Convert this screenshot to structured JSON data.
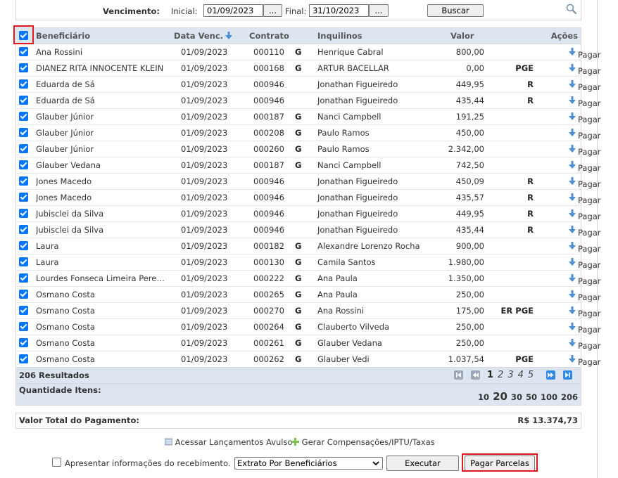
{
  "filter": {
    "label": "Vencimento:",
    "initial_label": "Inicial:",
    "initial_value": "01/09/2023",
    "final_label": "Final:",
    "final_value": "31/10/2023",
    "picker_label": "...",
    "search_label": "Buscar"
  },
  "table": {
    "headers": {
      "beneficiario": "Beneficiário",
      "data_venc": "Data Venc.",
      "contrato": "Contrato",
      "inquilinos": "Inquilinos",
      "valor": "Valor",
      "acoes": "Ações"
    },
    "pay_label": "Pagar",
    "rows": [
      {
        "beneficiario": "Ana Rossini",
        "data": "01/09/2023",
        "contrato": "000110",
        "g": "G",
        "inquilino": "Henrique Cabral",
        "valor": "800,00",
        "flag": ""
      },
      {
        "beneficiario": "DIANEZ RITA INNOCENTE KLEIN",
        "data": "01/09/2023",
        "contrato": "000168",
        "g": "G",
        "inquilino": "ARTUR BACELLAR",
        "valor": "0,00",
        "flag": "PGE"
      },
      {
        "beneficiario": "Eduarda de Sá",
        "data": "01/09/2023",
        "contrato": "000946",
        "g": "",
        "inquilino": "Jonathan Figueiredo",
        "valor": "449,95",
        "flag": "R"
      },
      {
        "beneficiario": "Eduarda de Sá",
        "data": "01/09/2023",
        "contrato": "000946",
        "g": "",
        "inquilino": "Jonathan Figueiredo",
        "valor": "435,44",
        "flag": "R"
      },
      {
        "beneficiario": "Glauber Júnior",
        "data": "01/09/2023",
        "contrato": "000187",
        "g": "G",
        "inquilino": "Nanci Campbell",
        "valor": "191,25",
        "flag": ""
      },
      {
        "beneficiario": "Glauber Júnior",
        "data": "01/09/2023",
        "contrato": "000208",
        "g": "G",
        "inquilino": "Paulo Ramos",
        "valor": "450,00",
        "flag": ""
      },
      {
        "beneficiario": "Glauber Júnior",
        "data": "01/09/2023",
        "contrato": "000260",
        "g": "G",
        "inquilino": "Paulo Ramos",
        "valor": "2.342,00",
        "flag": ""
      },
      {
        "beneficiario": "Glauber Vedana",
        "data": "01/09/2023",
        "contrato": "000187",
        "g": "G",
        "inquilino": "Nanci Campbell",
        "valor": "742,50",
        "flag": ""
      },
      {
        "beneficiario": "Jones Macedo",
        "data": "01/09/2023",
        "contrato": "000946",
        "g": "",
        "inquilino": "Jonathan Figueiredo",
        "valor": "450,09",
        "flag": "R"
      },
      {
        "beneficiario": "Jones Macedo",
        "data": "01/09/2023",
        "contrato": "000946",
        "g": "",
        "inquilino": "Jonathan Figueiredo",
        "valor": "435,57",
        "flag": "R"
      },
      {
        "beneficiario": "Jubisclei da Silva",
        "data": "01/09/2023",
        "contrato": "000946",
        "g": "",
        "inquilino": "Jonathan Figueiredo",
        "valor": "449,95",
        "flag": "R"
      },
      {
        "beneficiario": "Jubisclei da Silva",
        "data": "01/09/2023",
        "contrato": "000946",
        "g": "",
        "inquilino": "Jonathan Figueiredo",
        "valor": "435,44",
        "flag": "R"
      },
      {
        "beneficiario": "Laura",
        "data": "01/09/2023",
        "contrato": "000182",
        "g": "G",
        "inquilino": "Alexandre Lorenzo Rocha",
        "valor": "900,00",
        "flag": ""
      },
      {
        "beneficiario": "Laura",
        "data": "01/09/2023",
        "contrato": "000130",
        "g": "G",
        "inquilino": "Camila Santos",
        "valor": "1.980,00",
        "flag": ""
      },
      {
        "beneficiario": "Lourdes Fonseca Limeira Pereir...",
        "data": "01/09/2023",
        "contrato": "000222",
        "g": "G",
        "inquilino": "Ana Paula",
        "valor": "1.350,00",
        "flag": ""
      },
      {
        "beneficiario": "Osmano Costa",
        "data": "01/09/2023",
        "contrato": "000265",
        "g": "G",
        "inquilino": "Ana Paula",
        "valor": "250,00",
        "flag": ""
      },
      {
        "beneficiario": "Osmano Costa",
        "data": "01/09/2023",
        "contrato": "000270",
        "g": "G",
        "inquilino": "Ana Rossini",
        "valor": "175,00",
        "flag": "ER PGE"
      },
      {
        "beneficiario": "Osmano Costa",
        "data": "01/09/2023",
        "contrato": "000264",
        "g": "G",
        "inquilino": "Clauberto Vilveda",
        "valor": "250,00",
        "flag": ""
      },
      {
        "beneficiario": "Osmano Costa",
        "data": "01/09/2023",
        "contrato": "000261",
        "g": "G",
        "inquilino": "Glauber Vedana",
        "valor": "250,00",
        "flag": ""
      },
      {
        "beneficiario": "Osmano Costa",
        "data": "01/09/2023",
        "contrato": "000262",
        "g": "G",
        "inquilino": "Glauber Vedi",
        "valor": "1.037,54",
        "flag": "PGE"
      }
    ]
  },
  "pagination": {
    "results": "206 Resultados",
    "pages": [
      "1",
      "2",
      "3",
      "4",
      "5"
    ],
    "current_page": "1",
    "qty_label": "Quantidade Itens:",
    "page_sizes": [
      "10",
      "20",
      "30",
      "50",
      "100",
      "206"
    ],
    "current_size": "20"
  },
  "total": {
    "label": "Valor Total do Pagamento:",
    "value": "R$ 13.374,73"
  },
  "links": {
    "avulso": "Acessar Lançamentos Avulso",
    "compensacoes": "Gerar Compensações/IPTU/Taxas"
  },
  "bottom": {
    "checkbox_label": "Apresentar informações do recebimento.",
    "select_value": "Extrato Por Beneficiários",
    "executar": "Executar",
    "pagar_parcelas": "Pagar Parcelas"
  },
  "colors": {
    "accent": "#0075ff",
    "header_bg": "#dde6f0",
    "highlight": "#e0191f"
  }
}
